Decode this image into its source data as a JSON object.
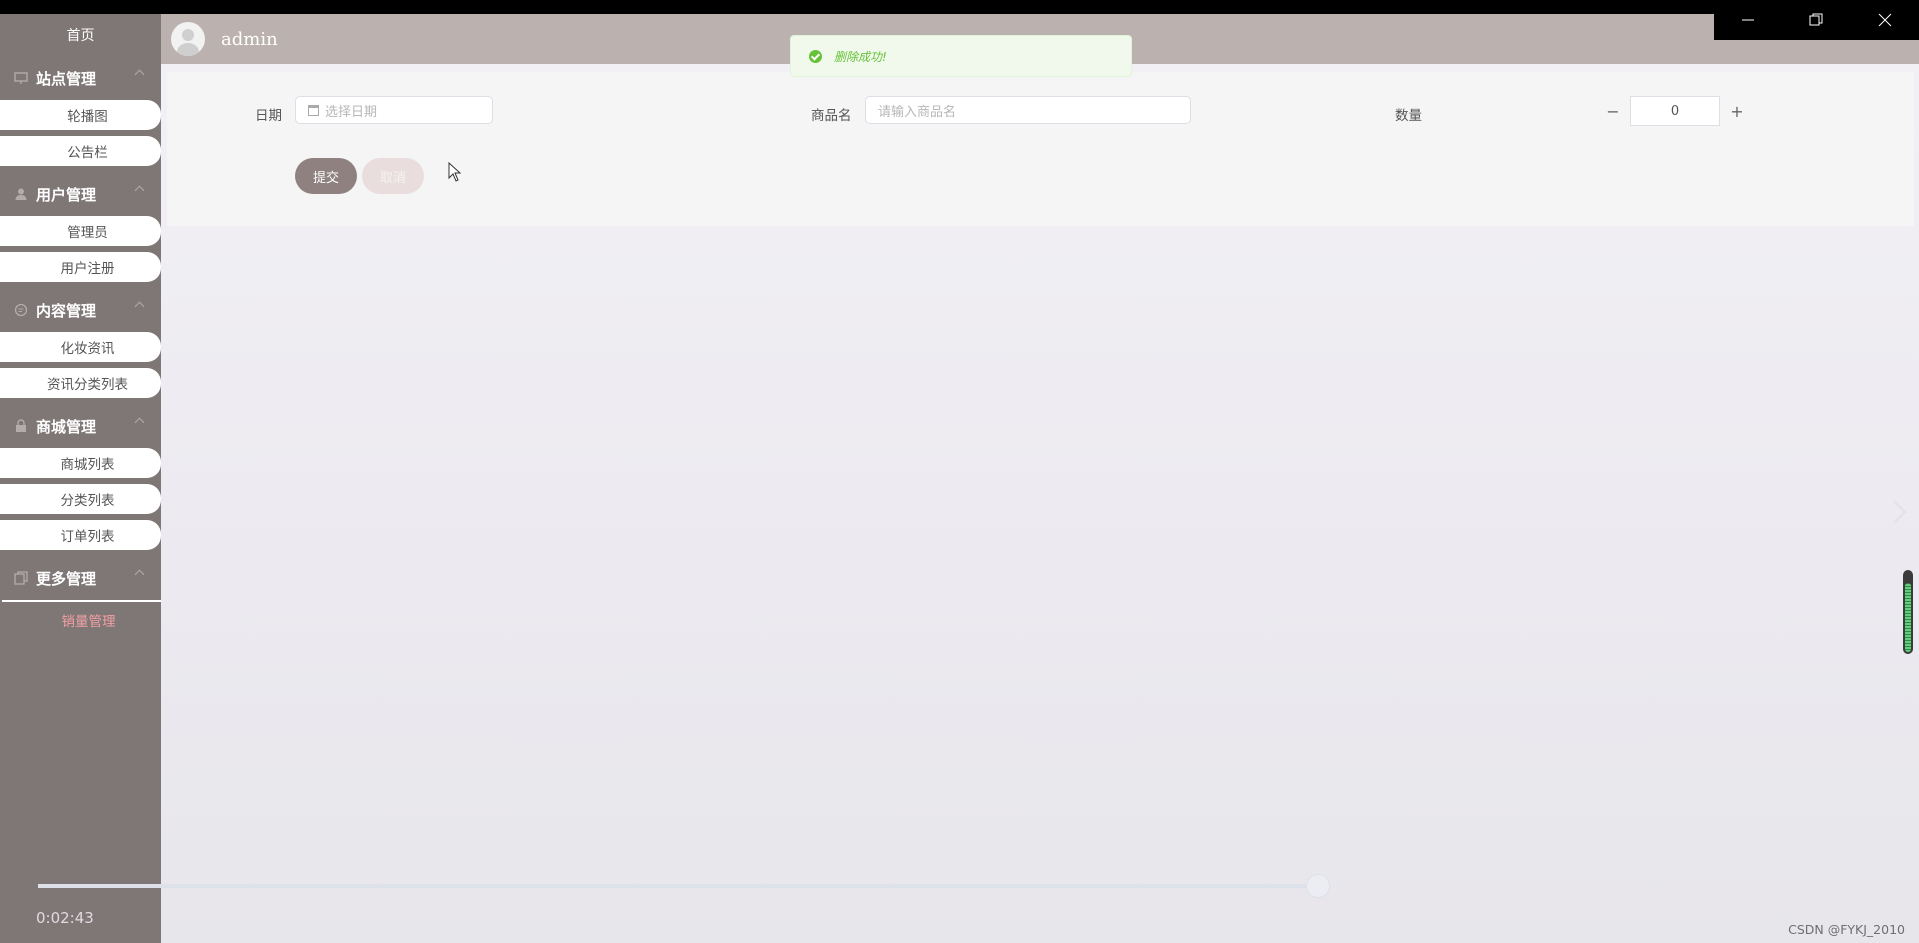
{
  "sidebar": {
    "home": "首页",
    "groups": [
      {
        "title": "站点管理",
        "icon": "monitor-icon",
        "items": [
          "轮播图",
          "公告栏"
        ]
      },
      {
        "title": "用户管理",
        "icon": "user-icon",
        "items": [
          "管理员",
          "用户注册"
        ]
      },
      {
        "title": "内容管理",
        "icon": "message-icon",
        "items": [
          "化妆资讯",
          "资讯分类列表"
        ]
      },
      {
        "title": "商城管理",
        "icon": "lock-icon",
        "items": [
          "商城列表",
          "分类列表",
          "订单列表"
        ]
      },
      {
        "title": "更多管理",
        "icon": "copy-icon",
        "items": [
          "销量管理"
        ]
      }
    ]
  },
  "header": {
    "username": "admin"
  },
  "toast": {
    "message": "删除成功!"
  },
  "form": {
    "date_label": "日期",
    "date_placeholder": "选择日期",
    "product_label": "商品名",
    "product_placeholder": "请输入商品名",
    "quantity_label": "数量",
    "quantity_value": "0",
    "minus": "−",
    "plus": "+",
    "submit": "提交",
    "cancel": "取消"
  },
  "video": {
    "time": "0:02:43",
    "progress": 0.83
  },
  "volume": {
    "level": 0.82
  },
  "watermark": "CSDN @FYKJ_2010",
  "colors": {
    "sidebar_bg": "#7f7676",
    "header_bg": "#bbb1ae",
    "primary_button": "#8e8180",
    "success": "#67c23a",
    "active_item": "#f2a0a4"
  }
}
